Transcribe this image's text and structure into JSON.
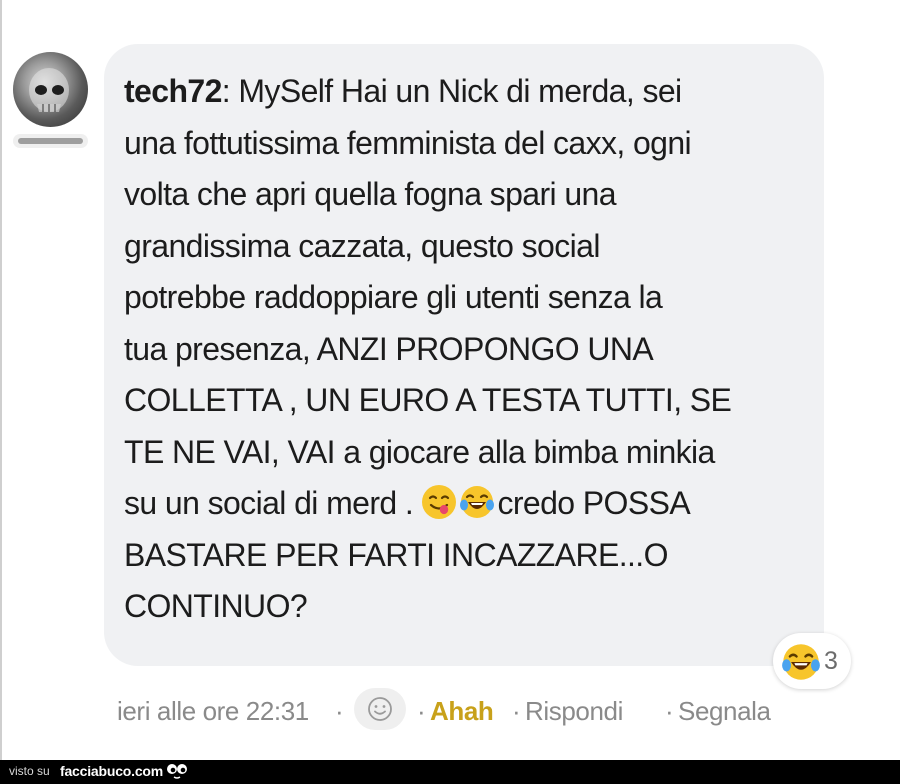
{
  "comment": {
    "author": "tech72",
    "lines": [
      ": MySelf Hai un Nick di merda, sei",
      "una fottutissima femminista del caxx, ogni",
      "volta che apri quella fogna spari una",
      "grandissima cazzata, questo social",
      "potrebbe raddoppiare gli utenti senza la",
      "tua presenza, ANZI PROPONGO UNA",
      "COLLETTA , UN EURO A TESTA TUTTI, SE",
      "TE NE VAI, VAI a giocare alla bimba minkia",
      "su un social di merd . ",
      "BASTARE PER FARTI INCAZZARE...O",
      "CONTINUO?"
    ],
    "line9_after_emoji": "credo POSSA",
    "inline_emojis": [
      "yum-face-emoji",
      "tears-of-joy-emoji"
    ]
  },
  "reaction": {
    "icon": "tears-of-joy-emoji",
    "count": "3"
  },
  "meta": {
    "timestamp": "ieri alle ore 22:31",
    "separator": "·",
    "react_icon": "smiley-icon",
    "ahah_label": "Ahah",
    "reply_label": "Rispondi",
    "report_label": "Segnala"
  },
  "footer": {
    "prefix": "visto su",
    "brand": "facciabuco.com",
    "logo_icon": "eyes-icon"
  },
  "colors": {
    "bubble": "#f0f1f3",
    "ahah": "#c8a11a",
    "meta": "#8a8a8a",
    "footer_bg": "#000000"
  }
}
